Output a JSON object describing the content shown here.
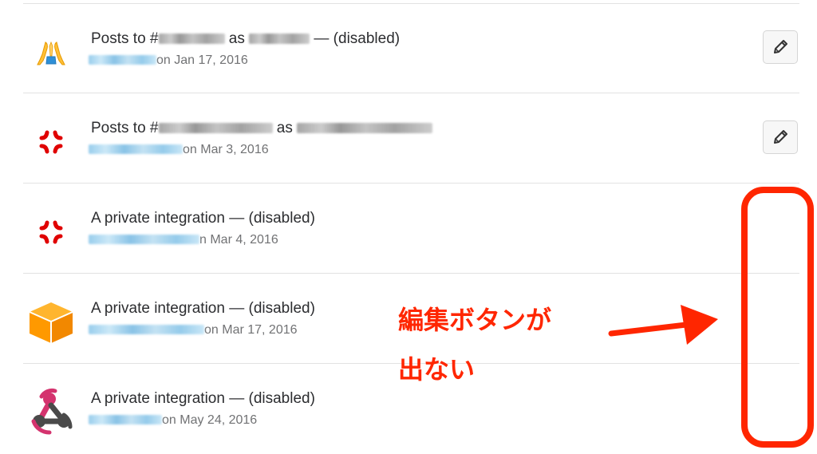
{
  "integrations": [
    {
      "icon": "folded-hands-icon",
      "title_prefix": "Posts to #",
      "title_middle": " as ",
      "title_suffix": " — (disabled)",
      "meta_suffix": "on Jan 17, 2016",
      "editable": true
    },
    {
      "icon": "anger-symbol-icon",
      "title_prefix": "Posts to #",
      "title_middle": " as ",
      "title_suffix": "",
      "meta_suffix": "on Mar 3, 2016",
      "editable": true
    },
    {
      "icon": "anger-symbol-icon",
      "title": "A private integration — (disabled)",
      "meta_suffix": "n Mar 4, 2016",
      "editable": false
    },
    {
      "icon": "amazon-box-icon",
      "title": "A private integration — (disabled)",
      "meta_suffix": "on Mar 17, 2016",
      "editable": false
    },
    {
      "icon": "webhook-icon",
      "title": "A private integration — (disabled)",
      "meta_suffix": "on May 24, 2016",
      "editable": false
    }
  ],
  "annotation": {
    "text_line_1": "編集ボタンが",
    "text_line_2": "出ない",
    "color": "#ff2600"
  },
  "colors": {
    "title_text": "#2c2d30",
    "meta_text": "#717274",
    "divider": "#e2e2e2",
    "edit_button_bg": "#f7f7f7",
    "edit_button_border": "#d5d5d5",
    "amazon_orange": "#ff9900"
  }
}
